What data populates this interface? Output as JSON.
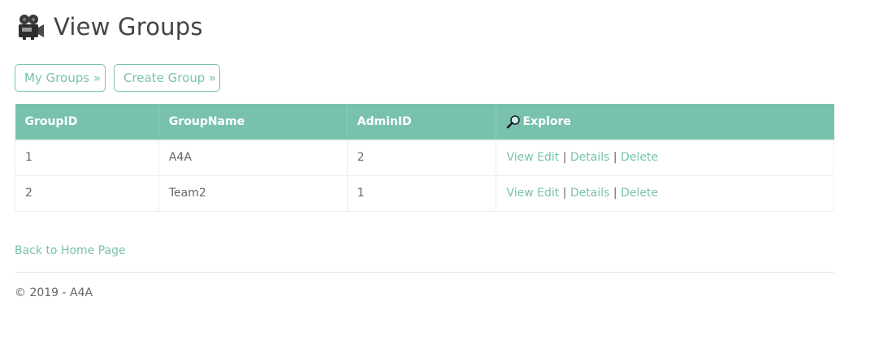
{
  "header": {
    "icon": "movie-camera-icon",
    "title": "View Groups"
  },
  "buttons": {
    "my_groups": "My Groups »",
    "create_group": "Create Group »"
  },
  "table": {
    "columns": [
      "GroupID",
      "GroupName",
      "AdminID",
      "Explore"
    ],
    "explore_icon": "magnifier-icon",
    "rows": [
      {
        "id": "1",
        "name": "A4A",
        "admin": "2",
        "view_edit": "View Edit",
        "details": "Details",
        "delete": "Delete",
        "sep": "|"
      },
      {
        "id": "2",
        "name": "Team2",
        "admin": "1",
        "view_edit": "View Edit",
        "details": "Details",
        "delete": "Delete",
        "sep": "|"
      }
    ]
  },
  "back_link": "Back to Home Page",
  "footer": "© 2019 - A4A",
  "colors": {
    "accent": "#78c2ad",
    "header_text": "#ffffff",
    "body_text": "#666666"
  }
}
